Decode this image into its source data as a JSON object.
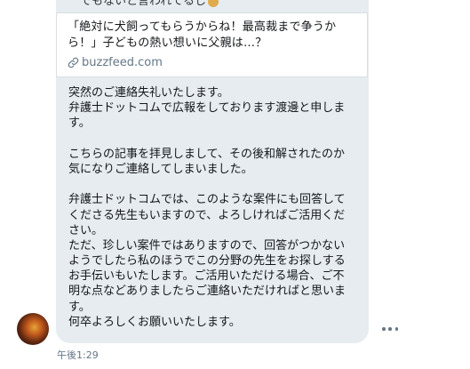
{
  "conversation": {
    "clipped_previous_text": "でもないと言われてるし",
    "link_card": {
      "title_line1": "「絶対に犬飼ってもらうからね！最高裁まで争うか",
      "title_line2": "ら！」子どもの熱い想いに父親は…？",
      "domain": "buzzfeed.com",
      "icon": "link-icon"
    },
    "message": {
      "lines": [
        "突然のご連絡失礼いたします。",
        "弁護士ドットコムで広報をしております渡邊と申しま",
        "す。",
        "",
        "こちらの記事を拝見しまして、その後和解されたのか",
        "気になりご連絡してしまいました。",
        "",
        "弁護士ドットコムでは、このような案件にも回答して",
        "くださる先生もいますので、よろしければご活用くだ",
        "さい。",
        "ただ、珍しい案件ではありますので、回答がつかない",
        "ようでしたら私のほうでこの分野の先生をお探しする",
        "お手伝いもいたします。ご活用いただける場合、ご不",
        "明な点などありましたらご連絡いただければと思いま",
        "す。",
        "何卒よろしくお願いいたします。"
      ]
    },
    "timestamp": "午後1:29",
    "more_icon": "more-horizontal-icon",
    "bubble_color": "#e6ecf0",
    "secondary_text_color": "#657786"
  }
}
